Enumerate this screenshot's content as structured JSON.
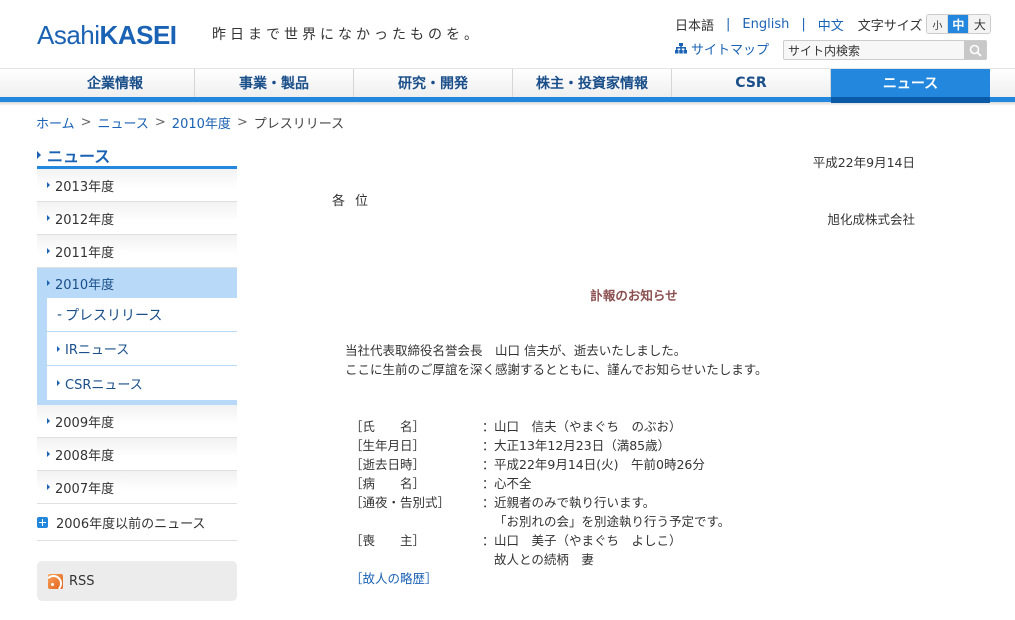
{
  "header": {
    "logo_part1": "Asahi",
    "logo_part2": "KASEI",
    "tagline": "昨日まで世界になかったものを。",
    "languages": [
      {
        "label": "日本語",
        "active": true
      },
      {
        "label": "English",
        "active": false
      },
      {
        "label": "中文",
        "active": false
      }
    ],
    "font_size_label": "文字サイズ",
    "font_sizes": [
      {
        "label": "小",
        "active": false
      },
      {
        "label": "中",
        "active": true
      },
      {
        "label": "大",
        "active": false
      }
    ],
    "sitemap_label": "サイトマップ",
    "search_placeholder": "サイト内検索"
  },
  "global_nav": {
    "items": [
      {
        "label": "企業情報",
        "active": false
      },
      {
        "label": "事業・製品",
        "active": false
      },
      {
        "label": "研究・開発",
        "active": false
      },
      {
        "label": "株主・投資家情報",
        "active": false
      },
      {
        "label": "CSR",
        "active": false
      },
      {
        "label": "ニュース",
        "active": true
      }
    ]
  },
  "breadcrumb": {
    "items": [
      "ホーム",
      "ニュース",
      "2010年度"
    ],
    "separator": ">",
    "current": "プレスリリース"
  },
  "sidebar": {
    "title": "ニュース",
    "years_before": [
      "2013年度",
      "2012年度",
      "2011年度"
    ],
    "active_year": "2010年度",
    "sub_items": [
      {
        "label": "プレスリリース",
        "current": true
      },
      {
        "label": "IRニュース",
        "current": false
      },
      {
        "label": "CSRニュース",
        "current": false
      }
    ],
    "years_after": [
      "2009年度",
      "2008年度",
      "2007年度"
    ],
    "older_news": "2006年度以前のニュース",
    "rss_label": "RSS"
  },
  "main": {
    "date": "平成22年9月14日",
    "addressee": "各位",
    "company": "旭化成株式会社",
    "title": "訃報のお知らせ",
    "intro_line1": "当社代表取締役名誉会長　山口 信夫が、逝去いたしました。",
    "intro_line2": "ここに生前のご厚誼を深く感謝するとともに、謹んでお知らせいたします。",
    "details": [
      {
        "label": "［氏　　名］",
        "value": "山口　信夫（やまぐち　のぶお）"
      },
      {
        "label": "［生年月日］",
        "value": "大正13年12月23日（満85歳）"
      },
      {
        "label": "［逝去日時］",
        "value": "平成22年9月14日(火)　午前0時26分"
      },
      {
        "label": "［病　　名］",
        "value": "心不全"
      },
      {
        "label": "［通夜・告別式］",
        "value": "近親者のみで執り行います。",
        "continuation": "「お別れの会」を別途執り行う予定です。"
      },
      {
        "label": "［喪　　主］",
        "value": "山口　美子（やまぐち　よしこ）",
        "continuation": "故人との続柄　妻"
      }
    ],
    "colon": "：",
    "biography_link": "［故人の略歴］"
  }
}
